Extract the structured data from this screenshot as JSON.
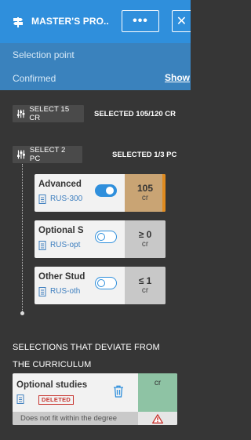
{
  "header": {
    "title": "MASTER'S PRO...",
    "more_label": "•••",
    "close_label": "✕",
    "accent_color": "#2f8fdc"
  },
  "info": {
    "selection_point_label": "Selection point",
    "status_label": "Confirmed",
    "show_link": "Show"
  },
  "group1": {
    "select_label": "SELECT 15 CR",
    "selected_count": "SELECTED 105/120 CR"
  },
  "group2": {
    "select_label": "SELECT 2 PC",
    "selected_count": "SELECTED 1/3 PC",
    "items": [
      {
        "name": "Advanced",
        "code": "RUS-300",
        "toggle": "on",
        "credit": "105",
        "unit": "cr"
      },
      {
        "name": "Optional S",
        "code": "RUS-opt",
        "toggle": "off",
        "credit": "≥ 0",
        "unit": "cr"
      },
      {
        "name": "Other Stud",
        "code": "RUS-oth",
        "toggle": "off",
        "credit": "≤ 1",
        "unit": "cr"
      }
    ]
  },
  "deviations": {
    "title": "SELECTIONS THAT DEVIATE FROM THE CURRICULUM",
    "item": {
      "name": "Optional studies",
      "badge": "DELETED",
      "credit_unit": "cr",
      "message": "Does not fit within the degree"
    }
  }
}
